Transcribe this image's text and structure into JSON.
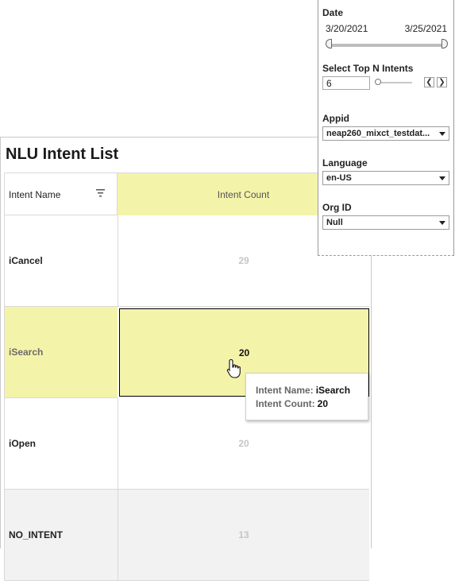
{
  "worksheet": {
    "title": "NLU Intent List",
    "columns": {
      "name": "Intent Name",
      "count": "Intent Count"
    },
    "rows": [
      {
        "name": "iCancel",
        "count": "29"
      },
      {
        "name": "iSearch",
        "count": "20"
      },
      {
        "name": "iOpen",
        "count": "20"
      },
      {
        "name": "NO_INTENT",
        "count": "13"
      }
    ]
  },
  "tooltip": {
    "name_key": "Intent Name:",
    "name_val": "iSearch",
    "count_key": "Intent Count:",
    "count_val": "20"
  },
  "filters": {
    "date": {
      "label": "Date",
      "min": "3/20/2021",
      "max": "3/25/2021"
    },
    "topn": {
      "label": "Select Top N Intents",
      "value": "6"
    },
    "appid": {
      "label": "Appid",
      "value": "neap260_mixct_testdat..."
    },
    "language": {
      "label": "Language",
      "value": "en-US"
    },
    "org": {
      "label": "Org ID",
      "value": "Null"
    }
  },
  "colors": {
    "highlight": "#f4f3aa",
    "muted_value": "#c6c6c6"
  }
}
